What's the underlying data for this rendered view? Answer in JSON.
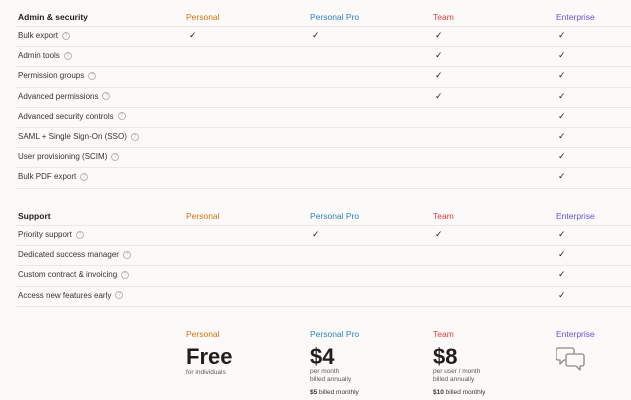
{
  "plans": {
    "personal": "Personal",
    "pro": "Personal Pro",
    "team": "Team",
    "enterprise": "Enterprise"
  },
  "admin_section": {
    "title": "Admin & security",
    "rows": [
      {
        "label": "Bulk export",
        "checks": [
          true,
          true,
          true,
          true
        ]
      },
      {
        "label": "Admin tools",
        "checks": [
          false,
          false,
          true,
          true
        ]
      },
      {
        "label": "Permission groups",
        "checks": [
          false,
          false,
          true,
          true
        ]
      },
      {
        "label": "Advanced permissions",
        "checks": [
          false,
          false,
          true,
          true
        ]
      },
      {
        "label": "Advanced security controls",
        "checks": [
          false,
          false,
          false,
          true
        ]
      },
      {
        "label": "SAML + Single Sign-On (SSO)",
        "checks": [
          false,
          false,
          false,
          true
        ]
      },
      {
        "label": "User provisioning (SCIM)",
        "checks": [
          false,
          false,
          false,
          true
        ]
      },
      {
        "label": "Bulk PDF export",
        "checks": [
          false,
          false,
          false,
          true
        ]
      }
    ]
  },
  "support_section": {
    "title": "Support",
    "rows": [
      {
        "label": "Priority support",
        "checks": [
          false,
          true,
          true,
          true
        ]
      },
      {
        "label": "Dedicated success manager",
        "checks": [
          false,
          false,
          false,
          true
        ]
      },
      {
        "label": "Custom contract & invoicing",
        "checks": [
          false,
          false,
          false,
          true
        ]
      },
      {
        "label": "Access new features early",
        "checks": [
          false,
          false,
          false,
          true
        ]
      }
    ]
  },
  "pricing": {
    "personal": {
      "name": "Personal",
      "price": "Free",
      "note1": "for individuals"
    },
    "pro": {
      "name": "Personal Pro",
      "price": "$4",
      "note1": "per month",
      "note2": "billed annually",
      "alt_price": "$5",
      "alt_note": "billed monthly"
    },
    "team": {
      "name": "Team",
      "price": "$8",
      "note1": "per user / month",
      "note2": "billed annually",
      "alt_price": "$10",
      "alt_note": "billed monthly"
    },
    "enterprise": {
      "name": "Enterprise",
      "icon": "chat-bubbles-icon"
    }
  },
  "check_glyph": "✓",
  "help_glyph": "?",
  "colors": {
    "personal": "#d9730d",
    "pro": "#2e83c3",
    "team": "#e03e3e",
    "enterprise": "#6753e0"
  }
}
